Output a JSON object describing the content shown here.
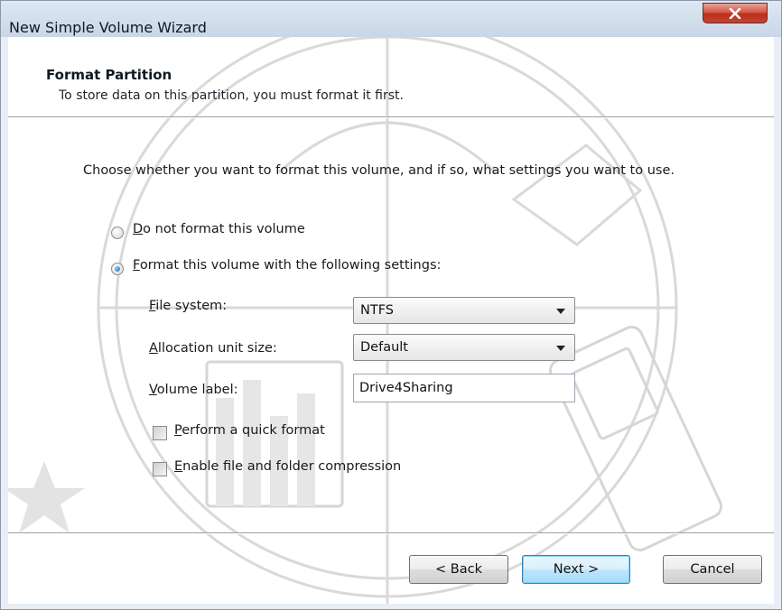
{
  "window": {
    "title": "New Simple Volume Wizard",
    "close_glyph": "X"
  },
  "header": {
    "title": "Format Partition",
    "subtitle": "To store data on this partition, you must format it first."
  },
  "instruction": "Choose whether you want to format this volume, and if so, what settings you want to use.",
  "options": {
    "no_format": {
      "label": "Do not format this volume",
      "selected": false
    },
    "format": {
      "label": "Format this volume with the following settings:",
      "selected": true
    }
  },
  "settings": {
    "file_system": {
      "label": "File system:",
      "value": "NTFS"
    },
    "allocation_unit_size": {
      "label": "Allocation unit size:",
      "value": "Default"
    },
    "volume_label": {
      "label": "Volume label:",
      "value": "Drive4Sharing"
    }
  },
  "checkboxes": {
    "quick_format": {
      "label": "Perform a quick format",
      "checked": false
    },
    "compression": {
      "label": "Enable file and folder compression",
      "checked": false
    }
  },
  "buttons": {
    "back": "< Back",
    "next": "Next >",
    "cancel": "Cancel"
  },
  "colors": {
    "close_button": "#c8412f",
    "default_button_border": "#3c7fb1",
    "radio_dot": "#1a5fb4"
  }
}
